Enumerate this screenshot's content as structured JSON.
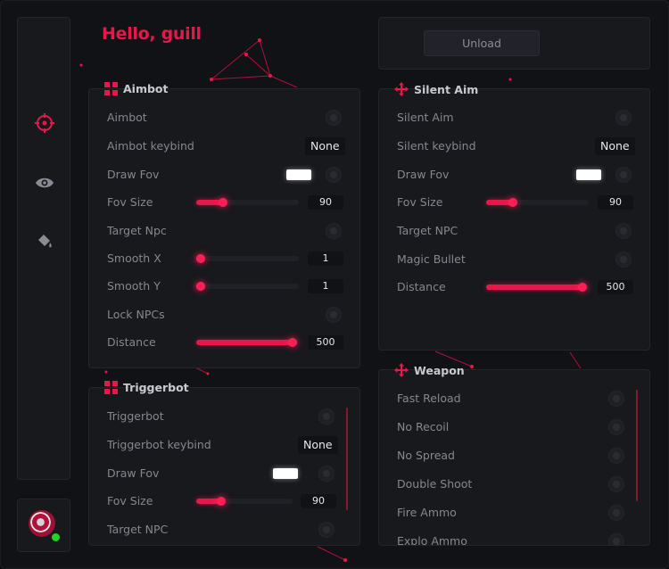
{
  "greeting": "Hello, guill",
  "accent_color": "#e8174a",
  "sidebar": {
    "items": [
      {
        "icon": "crosshair-icon",
        "active": true
      },
      {
        "icon": "eye-icon",
        "active": false
      },
      {
        "icon": "paint-bucket-icon",
        "active": false
      }
    ],
    "avatar_status_color": "#22d31f"
  },
  "unload_label": "Unload",
  "aimbot": {
    "title": "Aimbot",
    "rows": {
      "aimbot": "Aimbot",
      "keybind_label": "Aimbot keybind",
      "keybind_value": "None",
      "draw_fov": "Draw Fov",
      "fov_size": "Fov Size",
      "fov_size_value": "90",
      "target_npc": "Target Npc",
      "smooth_x": "Smooth X",
      "smooth_x_value": "1",
      "smooth_y": "Smooth Y",
      "smooth_y_value": "1",
      "lock_npcs": "Lock NPCs",
      "distance": "Distance",
      "distance_value": "500"
    }
  },
  "silent_aim": {
    "title": "Silent Aim",
    "rows": {
      "silent_aim": "Silent Aim",
      "keybind_label": "Silent keybind",
      "keybind_value": "None",
      "draw_fov": "Draw Fov",
      "fov_size": "Fov Size",
      "fov_size_value": "90",
      "target_npc": "Target NPC",
      "magic_bullet": "Magic Bullet",
      "distance": "Distance",
      "distance_value": "500"
    }
  },
  "triggerbot": {
    "title": "Triggerbot",
    "rows": {
      "triggerbot": "Triggerbot",
      "keybind_label": "Triggerbot keybind",
      "keybind_value": "None",
      "draw_fov": "Draw Fov",
      "fov_size": "Fov Size",
      "fov_size_value": "90",
      "target_npc": "Target NPC"
    }
  },
  "weapon": {
    "title": "Weapon",
    "rows": {
      "fast_reload": "Fast Reload",
      "no_recoil": "No Recoil",
      "no_spread": "No Spread",
      "double_shoot": "Double Shoot",
      "fire_ammo": "Fire Ammo",
      "explo_ammo": "Explo Ammo"
    }
  },
  "slider_levels": {
    "aimbot_fov": 0.26,
    "aimbot_smooth_x": 0.02,
    "aimbot_smooth_y": 0.02,
    "aimbot_distance": 0.94,
    "silent_fov": 0.26,
    "silent_distance": 0.94,
    "trigger_fov": 0.26
  }
}
